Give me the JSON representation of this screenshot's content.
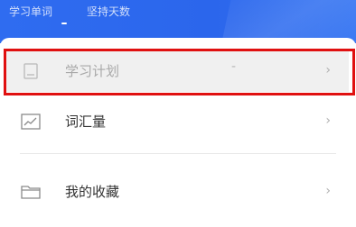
{
  "header": {
    "tabs": [
      {
        "label": "学习单词"
      },
      {
        "label": "坚持天数"
      }
    ],
    "accent": "#2f6cf0"
  },
  "menu": {
    "items": [
      {
        "label": "学习计划",
        "value": "-",
        "icon": "book-icon",
        "highlighted": true
      },
      {
        "label": "词汇量",
        "icon": "chart-line-icon"
      },
      {
        "label": "我的收藏",
        "icon": "folder-icon"
      }
    ],
    "chevron": "›"
  },
  "colors": {
    "highlight_border": "#e01010",
    "selected_row_bg": "#f0f0f0"
  }
}
